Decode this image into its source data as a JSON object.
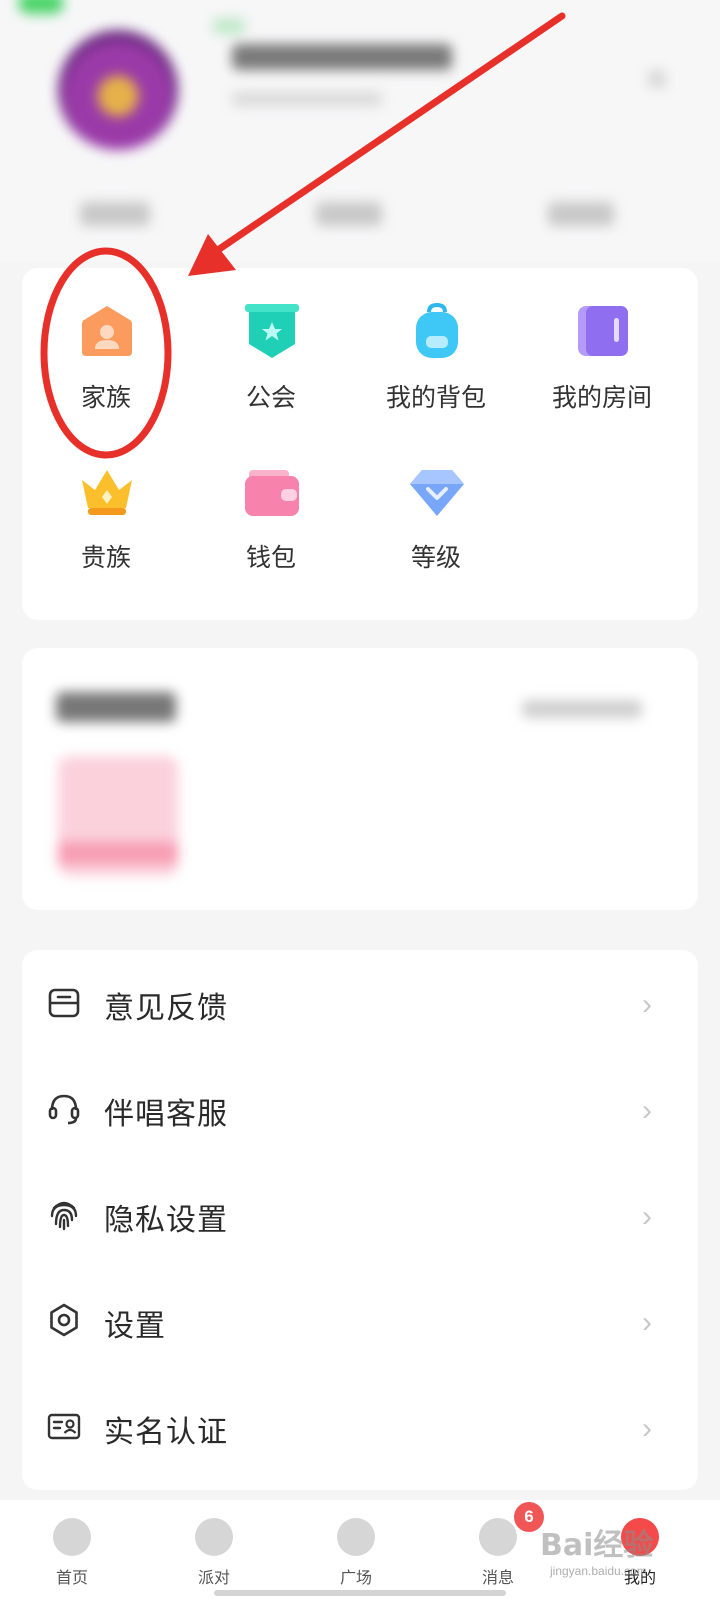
{
  "grid": {
    "items": [
      {
        "label": "家族",
        "icon": "family-icon",
        "color": "#fa9a5c"
      },
      {
        "label": "公会",
        "icon": "guild-icon",
        "color": "#2fd6c1"
      },
      {
        "label": "我的背包",
        "icon": "backpack-icon",
        "color": "#3cc6f5"
      },
      {
        "label": "我的房间",
        "icon": "room-icon",
        "color": "#9b7bf3"
      },
      {
        "label": "贵族",
        "icon": "crown-icon",
        "color": "#f9b526"
      },
      {
        "label": "钱包",
        "icon": "wallet-icon",
        "color": "#f77aa6"
      },
      {
        "label": "等级",
        "icon": "diamond-icon",
        "color": "#6f9cf6"
      }
    ]
  },
  "menu": {
    "items": [
      {
        "label": "意见反馈",
        "icon": "feedback-icon"
      },
      {
        "label": "伴唱客服",
        "icon": "headset-icon"
      },
      {
        "label": "隐私设置",
        "icon": "fingerprint-icon"
      },
      {
        "label": "设置",
        "icon": "gear-icon"
      },
      {
        "label": "实名认证",
        "icon": "id-card-icon"
      }
    ]
  },
  "nav": {
    "items": [
      {
        "label": "首页",
        "icon": "home-icon"
      },
      {
        "label": "派对",
        "icon": "party-icon"
      },
      {
        "label": "广场",
        "icon": "square-icon"
      },
      {
        "label": "消息",
        "icon": "message-icon",
        "badge": "6"
      },
      {
        "label": "我的",
        "icon": "me-icon",
        "active": true
      }
    ]
  },
  "watermark": {
    "logo": "Bai经验",
    "sub": "jingyan.baidu.com"
  },
  "annotation_color": "#e8302a"
}
